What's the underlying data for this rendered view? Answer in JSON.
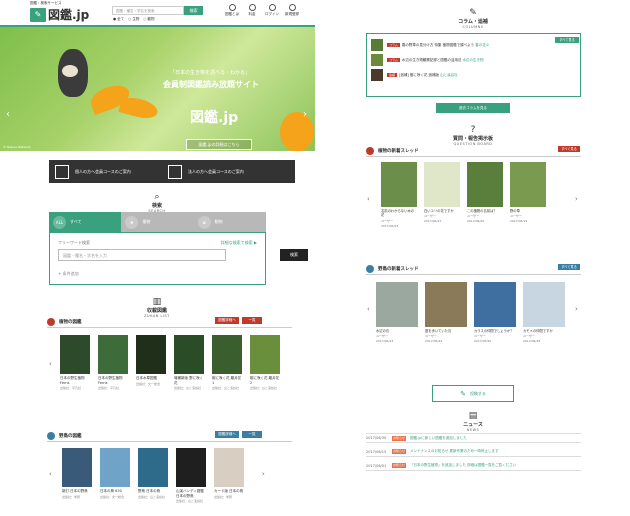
{
  "header": {
    "tagline": "図鑑・検索サービス",
    "logo": "図鑑.jp",
    "search_placeholder": "図鑑・種名・学名を検索",
    "search_button": "検索",
    "radio1": "全て",
    "radio2": "生物",
    "radio3": "動物",
    "icons": [
      "図鑑とは",
      "料金",
      "ログイン",
      "新規登録"
    ]
  },
  "hero": {
    "tagline": "「日本の生き物を調べる・わかる」",
    "title": "会員制図鑑読み放題サイト",
    "logo": "図鑑.jp",
    "button": "図鑑.jpの詳細はこちら",
    "credit": "© Nature Network"
  },
  "guides": [
    {
      "label": "個人の方へ会員コースのご案内"
    },
    {
      "label": "法人の方へ会員コースのご案内"
    }
  ],
  "search": {
    "icon": "search-icon",
    "title": "検索",
    "en": "SEARCH",
    "tabs": [
      {
        "label": "すべて",
        "icon": "ALL"
      },
      {
        "label": "植物",
        "icon": "♣"
      },
      {
        "label": "動物",
        "icon": "✿"
      }
    ],
    "keyword_label": "フリーワード検索",
    "advanced": "詳細な検索で検索 ▶",
    "input_placeholder": "図鑑・種名・学名を入力",
    "button": "検索",
    "condition": "+ 条件追加"
  },
  "zukan": {
    "title": "収載図鑑",
    "en": "ZUKAN LIST",
    "plant": {
      "label": "植物の図鑑",
      "btn1": "図鑑詳細へ",
      "btn2": "一覧"
    },
    "plant_books": [
      {
        "title": "日本の野生植物 Ferns",
        "meta": "出版社：平凡社"
      },
      {
        "title": "日本の野生植物 Ferns",
        "meta": "出版社：平凡社"
      },
      {
        "title": "日本水草図鑑",
        "meta": "出版社：文一総合"
      },
      {
        "title": "増補新版 野に咲く花",
        "meta": "出版社：山と溪谷社"
      },
      {
        "title": "樹に咲く花 離弁花1",
        "meta": "出版社：山と溪谷社"
      },
      {
        "title": "樹に咲く花 離弁花2",
        "meta": "出版社：山と溪谷社"
      }
    ],
    "wild": {
      "label": "野鳥の図鑑",
      "btn1": "図鑑詳細へ",
      "btn2": "一覧"
    },
    "wild_books": [
      {
        "title": "新訂 日本の野鳥",
        "meta": "出版社：学研"
      },
      {
        "title": "日本の鳥 630",
        "meta": "出版社：文一総合"
      },
      {
        "title": "野鳥 日本の鳥",
        "meta": "出版社：山と溪谷社"
      },
      {
        "title": "山溪ハンディ図鑑 日本の野鳥",
        "meta": "出版社：山と溪谷社"
      },
      {
        "title": "カード版 日本の鳥",
        "meta": "出版社：学研"
      }
    ]
  },
  "column": {
    "icon": "pen-icon",
    "title": "コラム・追補",
    "en": "COLUMNS",
    "more": "すべて見る",
    "items": [
      {
        "tag": "コラム",
        "text": "春の野草の見分け方 特集 植物図鑑で調べよう",
        "sub": "春の花々"
      },
      {
        "tag": "コラム",
        "text": "水辺の生き物観察記録と図鑑の活用法",
        "sub": "水辺の生き物"
      },
      {
        "tag": "追補",
        "text": "[追補] 樹に咲く花 追補版",
        "sub": "山と溪谷社"
      }
    ],
    "button": "過去コラムを見る"
  },
  "qa": {
    "icon": "question-icon",
    "title": "質問・報告掲示板",
    "en": "QUESTION BOARD"
  },
  "plant_thread": {
    "label": "植物の新着スレッド",
    "more": "すべて見る",
    "items": [
      {
        "title": "名前のわからない木の花",
        "user": "ユーザー",
        "date": "2017/06/23"
      },
      {
        "title": "白いユリの花ですか",
        "user": "ユーザー",
        "date": "2017/06/21"
      },
      {
        "title": "この植物の名前は？",
        "user": "ユーザー",
        "date": "2017/06/20"
      },
      {
        "title": "野の草",
        "user": "ユーザー",
        "date": "2017/06/19"
      }
    ]
  },
  "bird_thread": {
    "label": "野鳥の新着スレッド",
    "more": "すべて見る",
    "items": [
      {
        "title": "水辺の鳥",
        "user": "ユーザー",
        "date": "2017/06/23"
      },
      {
        "title": "庭を歩いていた鳥",
        "user": "ユーザー",
        "date": "2017/06/22"
      },
      {
        "title": "カラスの仲間でしょうか？",
        "user": "ユーザー",
        "date": "2017/06/20"
      },
      {
        "title": "カモメの仲間ですか",
        "user": "ユーザー",
        "date": "2017/06/18"
      }
    ]
  },
  "post_button": "投稿する",
  "news": {
    "icon": "news-icon",
    "title": "ニュース",
    "en": "NEWS",
    "items": [
      {
        "date": "2017/06/30",
        "cat": "お知らせ",
        "text": "図鑑.jpに新しい図鑑を追加しました"
      },
      {
        "date": "2017/06/15",
        "cat": "お知らせ",
        "text": "メンテナンスのお知らせ 更新作業のため一時停止します"
      },
      {
        "date": "2017/06/01",
        "cat": "お知らせ",
        "text": "「日本の野生植物」を追加しました 詳細は図鑑一覧をご覧ください"
      }
    ]
  },
  "colors": {
    "accent": "#3aa17e",
    "red": "#c0392b",
    "orange": "#e8734a"
  }
}
